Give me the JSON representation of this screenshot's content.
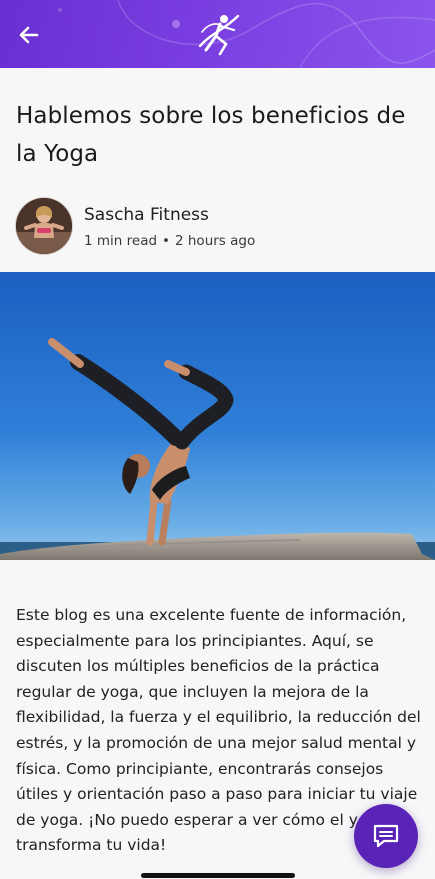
{
  "header": {
    "back_icon": "arrow-left-icon",
    "logo_icon": "dancer-logo-icon",
    "gradient_colors": [
      "#6a2fd1",
      "#8b55ec"
    ]
  },
  "article": {
    "title": "Hablemos sobre los beneficios de la Yoga",
    "author": "Sascha Fitness",
    "read_time": "1 min read",
    "separator": "•",
    "posted": "2 hours ago",
    "hero_image": "yoga-handstand-photo",
    "body": "Este blog es una excelente fuente de información, especialmente para los principiantes. Aquí, se discuten los múltiples beneficios de la práctica regular de yoga, que incluyen la mejora de la flexibilidad, la fuerza y el equilibrio, la reducción del estrés, y la promoción de una mejor salud mental y física. Como principiante, encontrarás consejos útiles y orientación paso a paso para iniciar tu viaje de yoga. ¡No puedo esperar a ver cómo el yoga transforma tu vida!"
  },
  "fab": {
    "icon": "chat-icon",
    "color": "#5a23b8"
  }
}
